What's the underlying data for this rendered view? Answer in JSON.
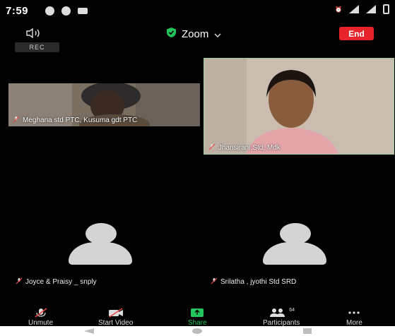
{
  "status": {
    "time": "7:59"
  },
  "header": {
    "meeting_title": "Zoom",
    "end_label": "End",
    "rec_label": "REC"
  },
  "participants": [
    {
      "name": "Meghana std PTC, Kusuma gdt PTC",
      "muted": true,
      "video": true
    },
    {
      "name": "Jhansirani,Std, Mdk",
      "muted": true,
      "video": true
    },
    {
      "name": "Joyce & Praisy _ snply",
      "muted": true,
      "video": false
    },
    {
      "name": "Srilatha , jyothi Std SRD",
      "muted": true,
      "video": false
    }
  ],
  "toolbar": {
    "unmute_label": "Unmute",
    "start_video_label": "Start Video",
    "share_label": "Share",
    "participants_label": "Participants",
    "participants_count": "64",
    "more_label": "More"
  },
  "colors": {
    "end_button": "#e8242a",
    "share_accent": "#22c55e",
    "shield": "#21c35a"
  },
  "icons": [
    "speaker-icon",
    "shield-icon",
    "chevron-down-icon",
    "mic-off-icon",
    "video-off-icon",
    "share-icon",
    "participants-icon",
    "more-icon"
  ]
}
